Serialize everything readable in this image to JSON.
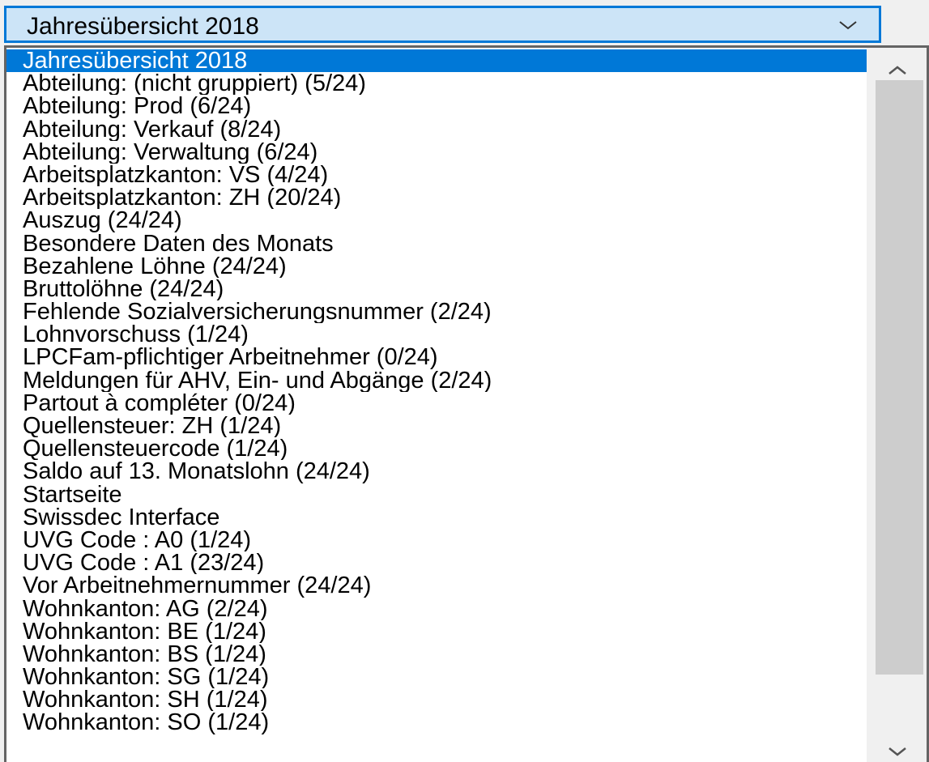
{
  "combo": {
    "selected_value": "Jahresübersicht 2018",
    "chevron_icon": "chevron-down-icon"
  },
  "dropdown": {
    "selected_index": 0,
    "items": [
      "Jahresübersicht 2018",
      "Abteilung: (nicht gruppiert) (5/24)",
      "Abteilung: Prod (6/24)",
      "Abteilung: Verkauf (8/24)",
      "Abteilung: Verwaltung (6/24)",
      "Arbeitsplatzkanton: VS (4/24)",
      "Arbeitsplatzkanton: ZH (20/24)",
      "Auszug (24/24)",
      "Besondere Daten des Monats",
      "Bezahlene Löhne (24/24)",
      "Bruttolöhne (24/24)",
      "Fehlende Sozialversicherungsnummer (2/24)",
      "Lohnvorschuss (1/24)",
      "LPCFam-pflichtiger Arbeitnehmer (0/24)",
      "Meldungen für AHV, Ein- und Abgänge (2/24)",
      "Partout à compléter (0/24)",
      "Quellensteuer: ZH (1/24)",
      "Quellensteuercode (1/24)",
      "Saldo auf 13. Monatslohn (24/24)",
      "Startseite",
      "Swissdec Interface",
      "UVG Code : A0 (1/24)",
      "UVG Code : A1 (23/24)",
      "Vor Arbeitnehmernummer (24/24)",
      "Wohnkanton: AG (2/24)",
      "Wohnkanton: BE (1/24)",
      "Wohnkanton: BS (1/24)",
      "Wohnkanton: SG (1/24)",
      "Wohnkanton: SH (1/24)",
      "Wohnkanton: SO (1/24)"
    ]
  },
  "scrollbar": {
    "up_icon": "chevron-up-icon",
    "down_icon": "chevron-down-icon"
  },
  "colors": {
    "accent": "#0078d7",
    "combo_background": "#cce4f7",
    "selected_text": "#ffffff",
    "scroll_thumb": "#cdcdcd"
  }
}
